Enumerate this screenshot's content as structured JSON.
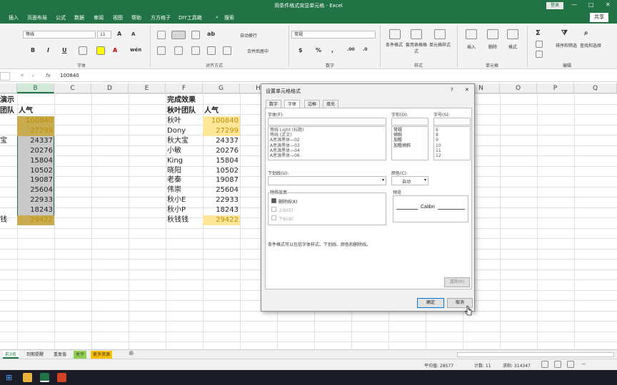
{
  "window": {
    "title": "用条件格式突显单元格 - Excel",
    "login": "登录",
    "share": "共享",
    "min": "—",
    "max": "□",
    "close": "✕"
  },
  "menu": [
    "插入",
    "页面布局",
    "公式",
    "数据",
    "审阅",
    "视图",
    "帮助",
    "方方格子",
    "DIY工具箱",
    "搜索"
  ],
  "ribbon": {
    "font_name": "等线",
    "font_size": "11",
    "number_format": "常规",
    "wrap_text": "自动换行",
    "merge_center": "合并后居中",
    "groups": {
      "font": "字体",
      "align": "对齐方式",
      "number": "数字",
      "styles": "样式",
      "cells": "单元格",
      "edit": "编辑"
    },
    "style_btns": [
      "条件格式",
      "套用表格格式",
      "单元格样式"
    ],
    "cell_btns": [
      "插入",
      "删除",
      "格式"
    ],
    "edit_btns": [
      "排序和筛选",
      "查找和选择"
    ],
    "format_btns": [
      "B",
      "I",
      "U",
      "A"
    ]
  },
  "formula_bar": {
    "fx": "fx",
    "value": "100840",
    "cancel": "✕",
    "enter": "✓"
  },
  "columns": [
    "B",
    "C",
    "D",
    "E",
    "F",
    "G",
    "H",
    "I",
    "J",
    "K",
    "L",
    "M",
    "N",
    "O",
    "P",
    "Q"
  ],
  "left_table": {
    "title": "演示",
    "h1": "团队",
    "h2": "人气",
    "rows": [
      {
        "n": "",
        "v": "100840"
      },
      {
        "n": "",
        "v": "27299"
      },
      {
        "n": "宝",
        "v": "24337"
      },
      {
        "n": "",
        "v": "20276"
      },
      {
        "n": "",
        "v": "15804"
      },
      {
        "n": "",
        "v": "10502"
      },
      {
        "n": "",
        "v": "19087"
      },
      {
        "n": "",
        "v": "25604"
      },
      {
        "n": "",
        "v": "22933"
      },
      {
        "n": "",
        "v": "18243"
      },
      {
        "n": "钱",
        "v": "29422"
      }
    ]
  },
  "right_table": {
    "title": "完成效果",
    "h1": "秋叶团队",
    "h2": "人气",
    "rows": [
      {
        "n": "秋叶",
        "v": "100840"
      },
      {
        "n": "Dony",
        "v": "27299"
      },
      {
        "n": "秋大宝",
        "v": "24337"
      },
      {
        "n": "小敏",
        "v": "20276"
      },
      {
        "n": "King",
        "v": "15804"
      },
      {
        "n": "晓阳",
        "v": "10502"
      },
      {
        "n": "老秦",
        "v": "19087"
      },
      {
        "n": "伟崇",
        "v": "25604"
      },
      {
        "n": "秋小E",
        "v": "22933"
      },
      {
        "n": "秋小P",
        "v": "18243"
      },
      {
        "n": "秋钱钱",
        "v": "29422"
      }
    ]
  },
  "colors": {
    "green": "#217346",
    "yellow": "#ffe699",
    "gold_text": "#bf8f00",
    "sel_fill": "#c9ab52"
  },
  "dialog": {
    "title": "设置单元格格式",
    "help": "?",
    "close": "✕",
    "tabs": [
      "数字",
      "字体",
      "边框",
      "填充"
    ],
    "font_label": "字体(F):",
    "style_label": "字形(O):",
    "size_label": "字号(S):",
    "fonts": [
      "等线 Light (标题)",
      "等线 (正文)",
      "A思源黑体—02",
      "A思源黑体—03",
      "A思源黑体—04",
      "A思源黑体—06"
    ],
    "styles": [
      "常规",
      "倾斜",
      "加粗",
      "加粗倾斜"
    ],
    "sizes": [
      "6",
      "8",
      "9",
      "10",
      "11",
      "12"
    ],
    "underline_label": "下划线(U):",
    "color_label": "颜色(C):",
    "color_value": "自动",
    "effects_label": "特殊效果",
    "strike": "删除线(K)",
    "sup": "上标(E)",
    "sub": "下标(B)",
    "preview_label": "预览",
    "preview_text": "Calibri",
    "note": "条件格式可以包括字体样式、下划线、颜色和删除线。",
    "clear": "清除(R)",
    "ok": "确定",
    "cancel": "取消"
  },
  "sheets": [
    "前3名",
    "到期提醒",
    "重复值",
    "关于",
    "更多资源"
  ],
  "status": {
    "avg": "平均值: 28577",
    "count": "计数: 11",
    "sum": "求和: 314347",
    "zoom": "—"
  }
}
